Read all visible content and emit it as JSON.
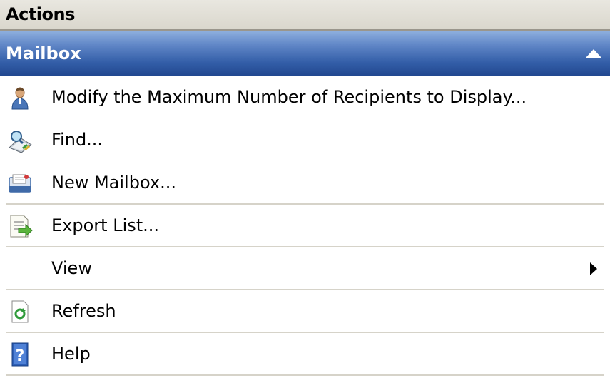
{
  "panel": {
    "title": "Actions",
    "section": {
      "title": "Mailbox",
      "collapse_icon": "collapse-up-icon",
      "items": [
        {
          "label": "Modify the Maximum Number of Recipients to Display...",
          "icon": "user-icon"
        },
        {
          "label": "Find...",
          "icon": "find-scanner-icon"
        },
        {
          "label": "New Mailbox...",
          "icon": "new-mailbox-icon"
        },
        {
          "label": "Export List...",
          "icon": "export-list-icon"
        },
        {
          "label": "View",
          "icon": "submenu-arrow-icon",
          "has_submenu": true
        },
        {
          "label": "Refresh",
          "icon": "refresh-icon"
        },
        {
          "label": "Help",
          "icon": "help-icon"
        }
      ]
    }
  },
  "colors": {
    "header_bg": "#dad7cd",
    "section_bg": "#335ea8",
    "separator": "#d6d3c9"
  }
}
